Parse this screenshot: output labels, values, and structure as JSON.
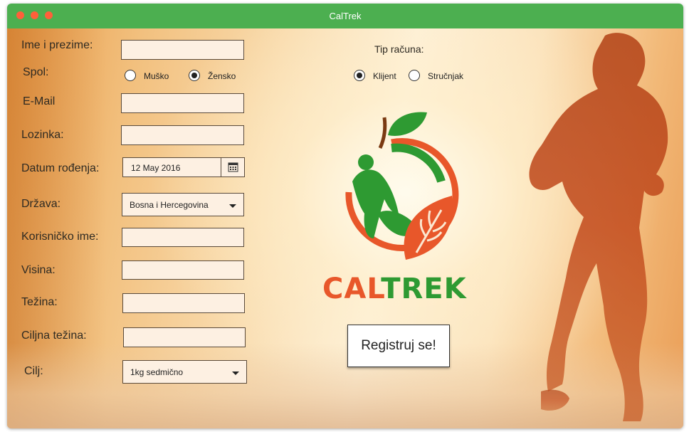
{
  "window": {
    "title": "CalTrek"
  },
  "form": {
    "full_name_label": "Ime  i prezime:",
    "gender_label": "Spol:",
    "gender_options": [
      "Muško",
      "Žensko"
    ],
    "gender_selected": "Žensko",
    "email_label": "E-Mail",
    "password_label": "Lozinka:",
    "birthdate_label": "Datum rođenja:",
    "birthdate_value": "12 May 2016",
    "country_label": "Država:",
    "country_value": "Bosna i Hercegovina",
    "username_label": "Korisničko ime:",
    "height_label": "Visina:",
    "weight_label": "Težina:",
    "target_weight_label": "Ciljna težina:",
    "goal_label": "Cilj:",
    "goal_value": "1kg sedmično"
  },
  "account_type": {
    "label": "Tip računa:",
    "options": [
      "Klijent",
      "Stručnjak"
    ],
    "selected": "Klijent"
  },
  "logo": {
    "part1": "CAL",
    "part2": "TREK"
  },
  "register_button": "Registruj se!",
  "colors": {
    "titlebar": "#4caf50",
    "logo_orange": "#e8572a",
    "logo_green": "#2e9a32"
  }
}
